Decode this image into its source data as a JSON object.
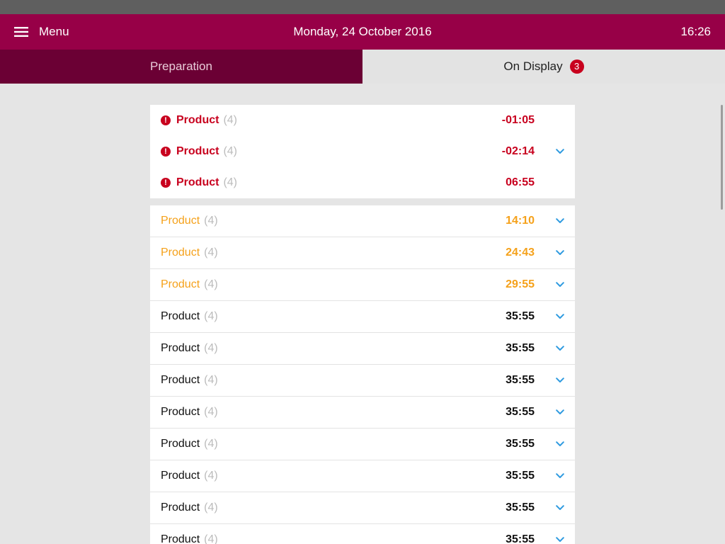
{
  "header": {
    "menu_label": "Menu",
    "date": "Monday, 24 October 2016",
    "time": "16:26"
  },
  "tabs": [
    {
      "label": "Preparation",
      "active": false
    },
    {
      "label": "On Display",
      "active": true,
      "badge": "3"
    }
  ],
  "urgent_items": [
    {
      "name": "Product",
      "qty": "(4)",
      "time": "-01:05",
      "status": "red",
      "expandable": false
    },
    {
      "name": "Product",
      "qty": "(4)",
      "time": "-02:14",
      "status": "red",
      "expandable": true
    },
    {
      "name": "Product",
      "qty": "(4)",
      "time": "06:55",
      "status": "red",
      "expandable": false
    }
  ],
  "items": [
    {
      "name": "Product",
      "qty": "(4)",
      "time": "14:10",
      "status": "orange"
    },
    {
      "name": "Product",
      "qty": "(4)",
      "time": "24:43",
      "status": "orange"
    },
    {
      "name": "Product",
      "qty": "(4)",
      "time": "29:55",
      "status": "orange"
    },
    {
      "name": "Product",
      "qty": "(4)",
      "time": "35:55",
      "status": "black"
    },
    {
      "name": "Product",
      "qty": "(4)",
      "time": "35:55",
      "status": "black"
    },
    {
      "name": "Product",
      "qty": "(4)",
      "time": "35:55",
      "status": "black"
    },
    {
      "name": "Product",
      "qty": "(4)",
      "time": "35:55",
      "status": "black"
    },
    {
      "name": "Product",
      "qty": "(4)",
      "time": "35:55",
      "status": "black"
    },
    {
      "name": "Product",
      "qty": "(4)",
      "time": "35:55",
      "status": "black"
    },
    {
      "name": "Product",
      "qty": "(4)",
      "time": "35:55",
      "status": "black"
    },
    {
      "name": "Product",
      "qty": "(4)",
      "time": "35:55",
      "status": "black"
    }
  ],
  "icons": {
    "menu": "hamburger-icon",
    "alert": "alert-icon",
    "expand": "chevron-down-icon"
  },
  "colors": {
    "header": "#970047",
    "tab_inactive": "#6b0034",
    "alert": "#c8001e",
    "warning": "#f5a11a",
    "accent": "#2f9be0"
  }
}
